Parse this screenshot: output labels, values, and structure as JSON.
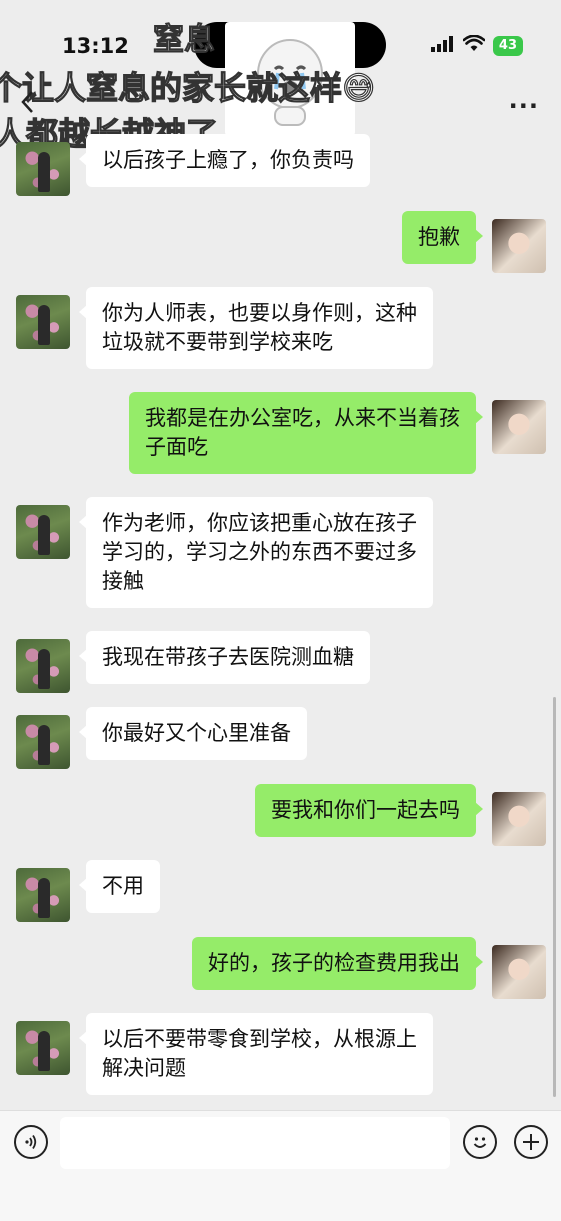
{
  "status_bar": {
    "time": "13:12",
    "battery": "43"
  },
  "overlay": {
    "title": "窒息",
    "line1": "个让人窒息的家长就这样😅",
    "line2": "人都越长越神了"
  },
  "header": {
    "more": "..."
  },
  "messages": [
    {
      "side": "left",
      "text": "以后孩子上瘾了，你负责吗"
    },
    {
      "side": "right",
      "text": "抱歉"
    },
    {
      "side": "left",
      "text": "你为人师表，也要以身作则，这种\n垃圾就不要带到学校来吃"
    },
    {
      "side": "right",
      "text": "我都是在办公室吃，从来不当着孩\n子面吃"
    },
    {
      "side": "left",
      "text": "作为老师，你应该把重心放在孩子\n学习的，学习之外的东西不要过多\n接触"
    },
    {
      "side": "left",
      "text": "我现在带孩子去医院测血糖"
    },
    {
      "side": "left",
      "text": "你最好又个心里准备"
    },
    {
      "side": "right",
      "text": "要我和你们一起去吗"
    },
    {
      "side": "left",
      "text": "不用"
    },
    {
      "side": "right",
      "text": "好的，孩子的检查费用我出"
    },
    {
      "side": "left",
      "text": "以后不要带零食到学校，从根源上\n解决问题"
    }
  ],
  "input_bar": {
    "value": "",
    "placeholder": "",
    "icons": [
      "voice-icon",
      "emoji-icon",
      "plus-icon"
    ]
  },
  "colors": {
    "background": "#ededed",
    "bubble_left": "#ffffff",
    "bubble_right": "#95ec69",
    "battery": "#3ac84a"
  }
}
